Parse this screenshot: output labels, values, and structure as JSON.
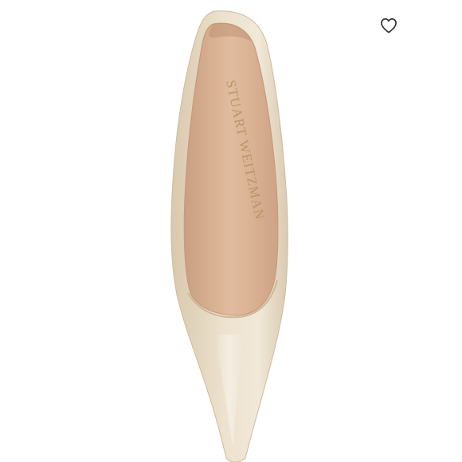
{
  "product": {
    "brand_print": "STUART WEITZMAN"
  },
  "actions": {
    "like_icon": "heart-outline-icon"
  },
  "colors": {
    "shoe": "#e9dcc6",
    "lining": "#dcb392",
    "brand_print": "#b8956a",
    "icon": "#2b2b2b"
  }
}
